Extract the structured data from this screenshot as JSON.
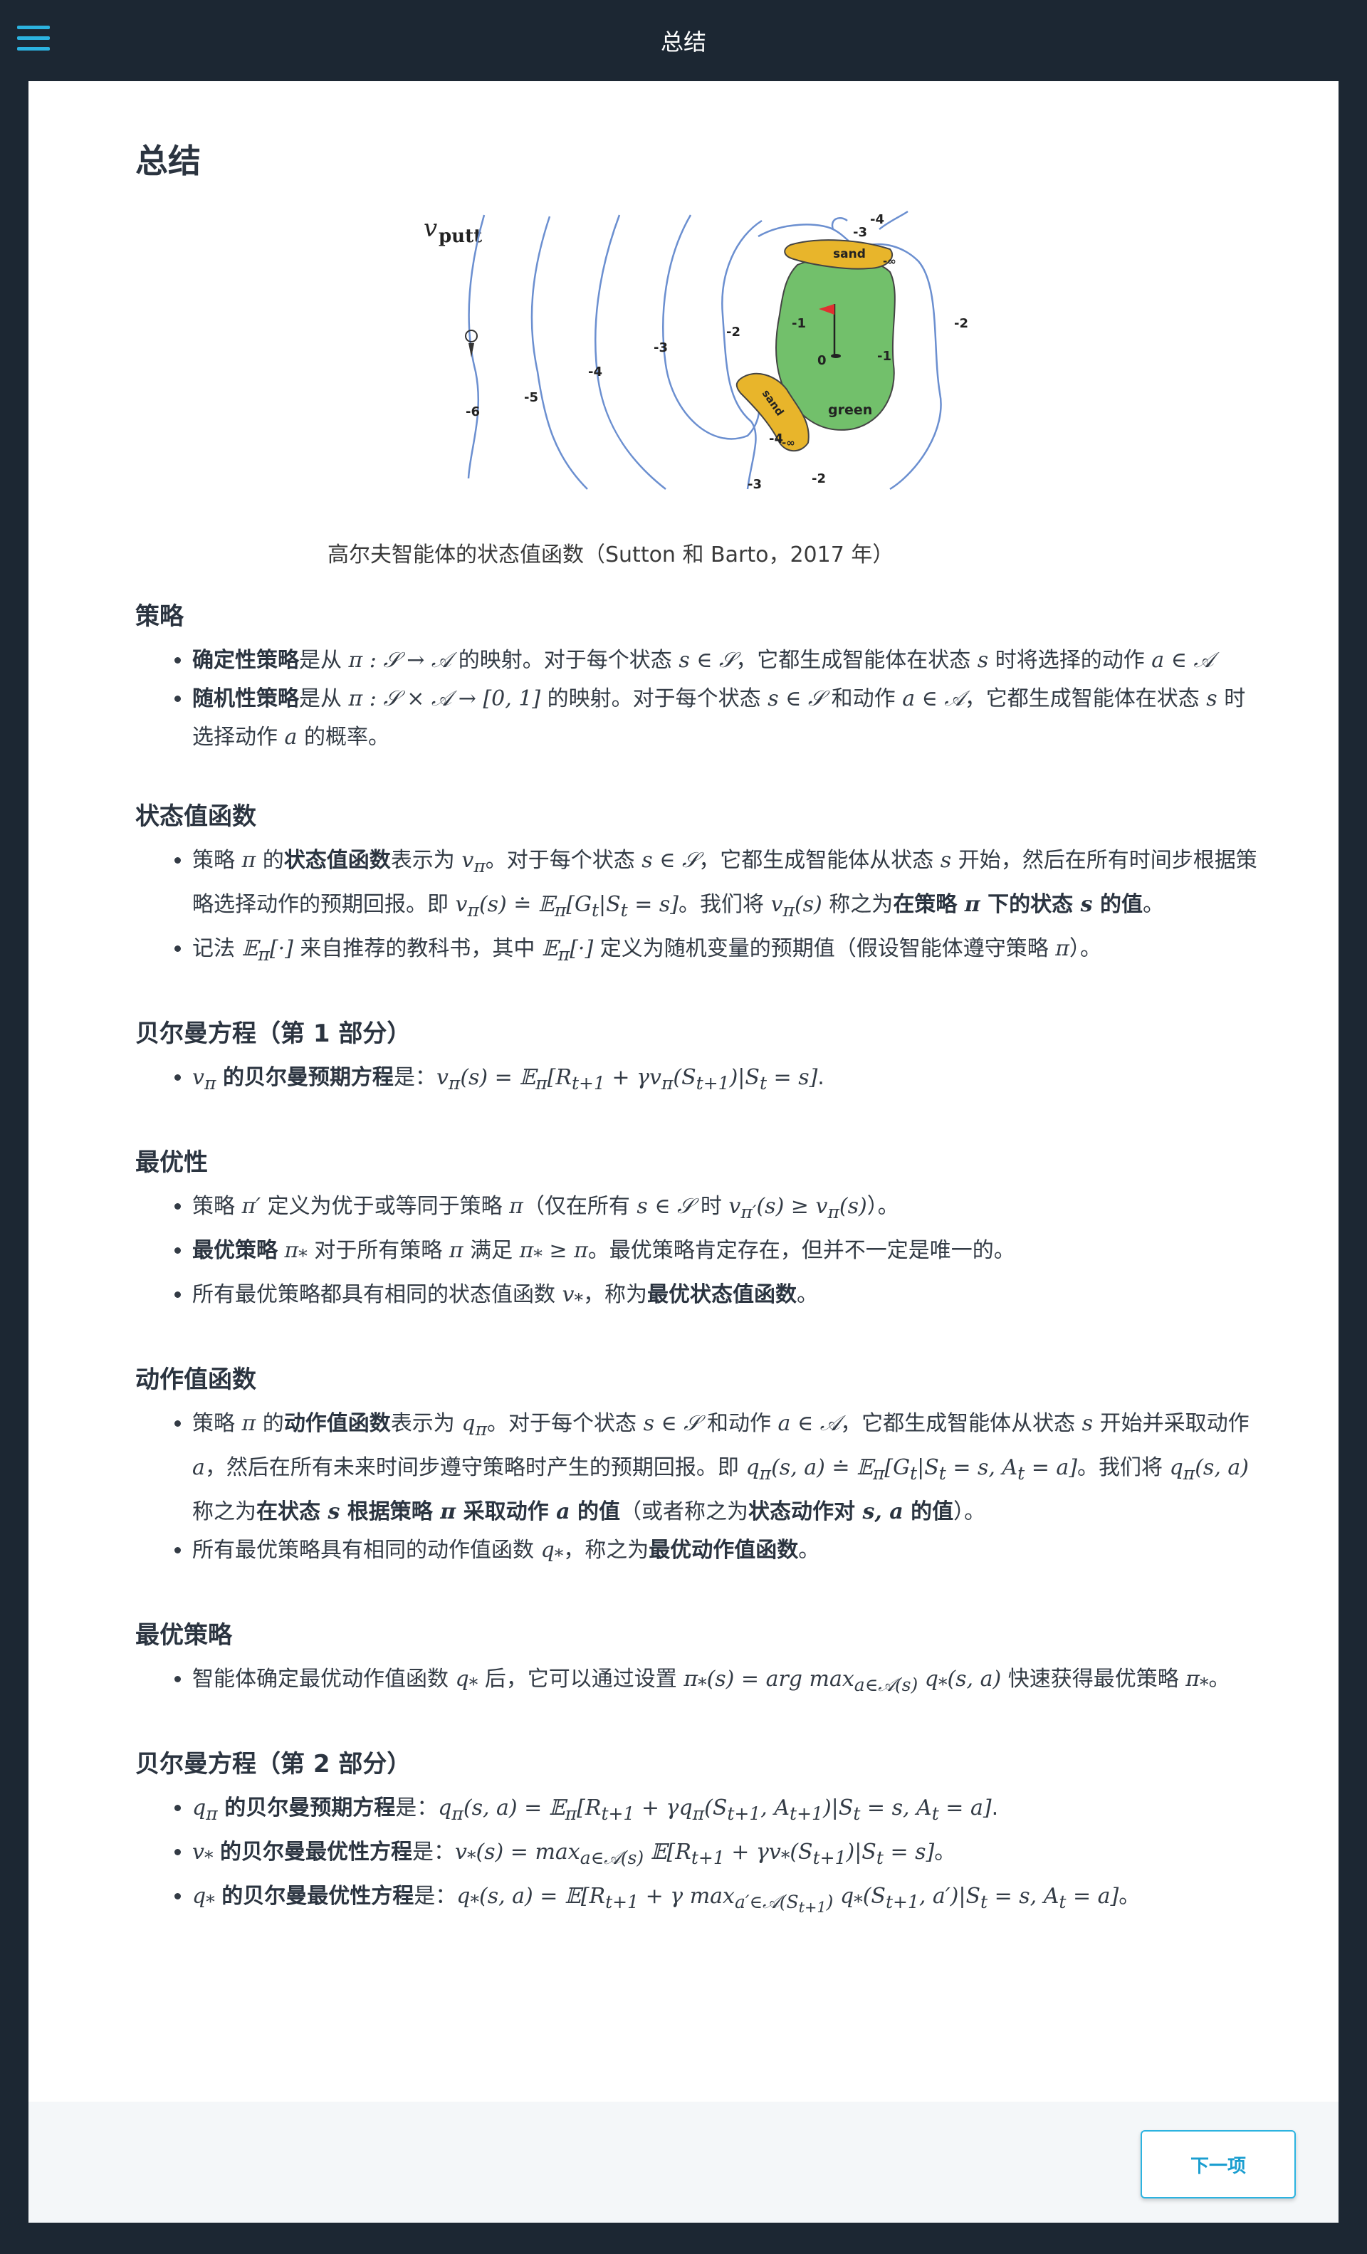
{
  "header": {
    "title": "总结",
    "menu_icon": "hamburger-menu-icon"
  },
  "page": {
    "title": "总结"
  },
  "figure": {
    "label": "v_putt",
    "caption": "高尔夫智能体的状态值函数（Sutton 和 Barto，2017 年）",
    "contour_labels": [
      "-6",
      "-5",
      "-4",
      "-3",
      "-2",
      "-1",
      "0",
      "-1",
      "-2",
      "-3",
      "-4",
      "-3",
      "-2",
      "-4"
    ],
    "sand_label": "sand",
    "green_label": "green",
    "neg_inf": "-∞",
    "colors": {
      "sand": "#e8b52b",
      "green": "#72c06b",
      "contour": "#6b8fd0",
      "flag": "#e03030"
    }
  },
  "sections": [
    {
      "heading": "策略",
      "items": [
        {
          "html": "<b>确定性策略</b>是从 <span class='m'>π : 𝒮 → 𝒜</span> 的映射。对于每个状态 <span class='m'>s ∈ 𝒮</span>，它都生成智能体在状态 <span class='m'>s</span> 时将选择的动作 <span class='m'>a ∈ 𝒜</span>"
        },
        {
          "html": "<b>随机性策略</b>是从 <span class='m'>π : 𝒮 × 𝒜 → [0, 1]</span> 的映射。对于每个状态 <span class='m'>s ∈ 𝒮</span> 和动作 <span class='m'>a ∈ 𝒜</span>，它都生成智能体在状态 <span class='m'>s</span> 时选择动作 <span class='m'>a</span> 的概率。"
        }
      ]
    },
    {
      "heading": "状态值函数",
      "items": [
        {
          "html": "策略 <span class='m'>π</span> 的<b>状态值函数</b>表示为 <span class='m'>v<sub>π</sub></span>。对于每个状态 <span class='m'>s ∈ 𝒮</span>，它都生成智能体从状态 <span class='m'>s</span> 开始，然后在所有时间步根据策略选择动作的预期回报。即 <span class='m'>v<sub>π</sub>(s) ≐ 𝔼<sub>π</sub>[G<sub>t</sub>|S<sub>t</sub> = s]</span>。我们将 <span class='m'>v<sub>π</sub>(s)</span> 称之为<b>在策略 <span class='m'>π</span> 下的状态 <span class='m'>s</span> 的值</b>。"
        },
        {
          "html": "记法 <span class='m'>𝔼<sub>π</sub>[·]</span> 来自推荐的教科书，其中 <span class='m'>𝔼<sub>π</sub>[·]</span> 定义为随机变量的预期值（假设智能体遵守策略 <span class='m'>π</span>）。"
        }
      ]
    },
    {
      "heading": "贝尔曼方程（第 1 部分）",
      "items": [
        {
          "html": "<span class='m'>v<sub>π</sub></span> <b>的贝尔曼预期方程</b>是：<span class='m'>v<sub>π</sub>(s) = 𝔼<sub>π</sub>[R<sub>t+1</sub> + γv<sub>π</sub>(S<sub>t+1</sub>)|S<sub>t</sub> = s]</span>."
        }
      ]
    },
    {
      "heading": "最优性",
      "items": [
        {
          "html": "策略 <span class='m'>π′</span> 定义为优于或等同于策略 <span class='m'>π</span>（仅在所有 <span class='m'>s ∈ 𝒮</span> 时 <span class='m'>v<sub>π′</sub>(s) ≥ v<sub>π</sub>(s)</span>）。"
        },
        {
          "html": "<b>最优策略</b> <span class='m'>π<sub>*</sub></span> 对于所有策略 <span class='m'>π</span> 满足 <span class='m'>π<sub>*</sub> ≥ π</span>。最优策略肯定存在，但并不一定是唯一的。"
        },
        {
          "html": "所有最优策略都具有相同的状态值函数 <span class='m'>v<sub>*</sub></span>，称为<b>最优状态值函数</b>。"
        }
      ]
    },
    {
      "heading": "动作值函数",
      "items": [
        {
          "html": "策略 <span class='m'>π</span> 的<b>动作值函数</b>表示为 <span class='m'>q<sub>π</sub></span>。对于每个状态 <span class='m'>s ∈ 𝒮</span> 和动作 <span class='m'>a ∈ 𝒜</span>，它都生成智能体从状态 <span class='m'>s</span> 开始并采取动作 <span class='m'>a</span>，然后在所有未来时间步遵守策略时产生的预期回报。即 <span class='m'>q<sub>π</sub>(s, a) ≐ 𝔼<sub>π</sub>[G<sub>t</sub>|S<sub>t</sub> = s, A<sub>t</sub> = a]</span>。我们将 <span class='m'>q<sub>π</sub>(s, a)</span> 称之为<b>在状态 <span class='m'>s</span> 根据策略 <span class='m'>π</span> 采取动作 <span class='m'>a</span> 的值</b>（或者称之为<b>状态动作对 <span class='m'>s, a</span> 的值</b>）。"
        },
        {
          "html": "所有最优策略具有相同的动作值函数 <span class='m'>q<sub>*</sub></span>，称之为<b>最优动作值函数</b>。"
        }
      ]
    },
    {
      "heading": "最优策略",
      "items": [
        {
          "html": "智能体确定最优动作值函数 <span class='m'>q<sub>*</sub></span> 后，它可以通过设置 <span class='m'>π<sub>*</sub>(s) = arg max<sub>a∈𝒜(s)</sub> q<sub>*</sub>(s, a)</span> 快速获得最优策略 <span class='m'>π<sub>*</sub></span>。"
        }
      ]
    },
    {
      "heading": "贝尔曼方程（第 2 部分）",
      "items": [
        {
          "html": "<span class='m'>q<sub>π</sub></span> <b>的贝尔曼预期方程</b>是：<span class='m'>q<sub>π</sub>(s, a) = 𝔼<sub>π</sub>[R<sub>t+1</sub> + γq<sub>π</sub>(S<sub>t+1</sub>, A<sub>t+1</sub>)|S<sub>t</sub> = s, A<sub>t</sub> = a]</span>."
        },
        {
          "html": "<span class='m'>v<sub>*</sub></span> <b>的贝尔曼最优性方程</b>是：<span class='m'>v<sub>*</sub>(s) = max<sub>a∈𝒜(s)</sub> 𝔼[R<sub>t+1</sub> + γv<sub>*</sub>(S<sub>t+1</sub>)|S<sub>t</sub> = s]</span>。"
        },
        {
          "html": "<span class='m'>q<sub>*</sub></span> <b>的贝尔曼最优性方程</b>是：<span class='m'>q<sub>*</sub>(s, a) = 𝔼[R<sub>t+1</sub> + γ max<sub>a′∈𝒜(S<sub>t+1</sub>)</sub> q<sub>*</sub>(S<sub>t+1</sub>, a′)|S<sub>t</sub> = s, A<sub>t</sub> = a]</span>。"
        }
      ]
    }
  ],
  "footer": {
    "next_label": "下一项"
  }
}
